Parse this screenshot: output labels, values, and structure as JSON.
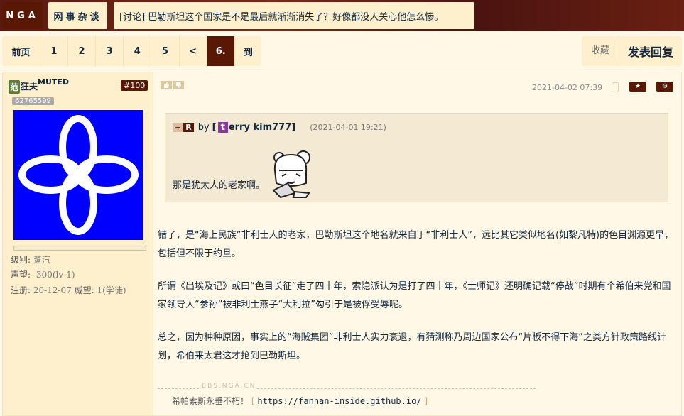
{
  "header": {
    "logo": "NGA",
    "forum": "网事杂谈",
    "thread_title": "[讨论] 巴勒斯坦这个国家是不是最后就渐渐消失了？好像都没人关心他怎么惨。"
  },
  "pager": {
    "first": "前页",
    "pages": [
      "1",
      "2",
      "3",
      "4",
      "5"
    ],
    "prev": "<",
    "current": "6.",
    "goto": "到"
  },
  "actions": {
    "favorite": "收藏",
    "reply": "发表回复"
  },
  "user": {
    "badge": "范",
    "name": "狂夫",
    "muted": "MUTED",
    "uid": "62765599",
    "level_label": "级别:",
    "level": "蒸汽",
    "rep_label": "声望:",
    "rep": "-300(lv-1)",
    "reg_label": "注册:",
    "reg": "20-12-07",
    "power_label": "威望:",
    "power": "1(学徒)"
  },
  "post": {
    "floor": "#100",
    "date": "2021-04-02 07:39",
    "quote": {
      "plus": "+",
      "r": "R",
      "by": "by",
      "open": "[",
      "initial": "t",
      "user": "erry kim777",
      "close": "]",
      "date": "(2021-04-01 19:21)",
      "text": "那是犹太人的老家啊。"
    },
    "paragraphs": [
      "错了，是“海上民族”非利士人的老家，巴勒斯坦这个地名就来自于“非利士人”，远比其它类似地名(如黎凡特)的色目渊源更早，包括但不限于约旦。",
      "所谓《出埃及记》或曰“色目长征”走了四十年，索隐派认为是打了四十年，《士师记》还明确记载“停战”时期有个希伯来党和国家领导人“参孙”被非利士燕子“大利拉”勾引于是被俘受辱呢。",
      "总之，因为种种原因，事实上的“海贼集团”非利士人实力衰退，有猜测称乃周边国家公布“片板不得下海”之类方针政策路线计划，希伯来太君这才抢到巴勒斯坦。"
    ],
    "watermark": "BBS.NGA.CN",
    "signature": {
      "text": "希帕索斯永垂不朽！",
      "open": "[",
      "url": "https://fanhan-inside.github.io/",
      "close": "]"
    }
  },
  "colors": {
    "accent": "#591804",
    "panel": "#fff0cd",
    "background": "#fff8e7",
    "avatar_bg": "#0000ff"
  }
}
